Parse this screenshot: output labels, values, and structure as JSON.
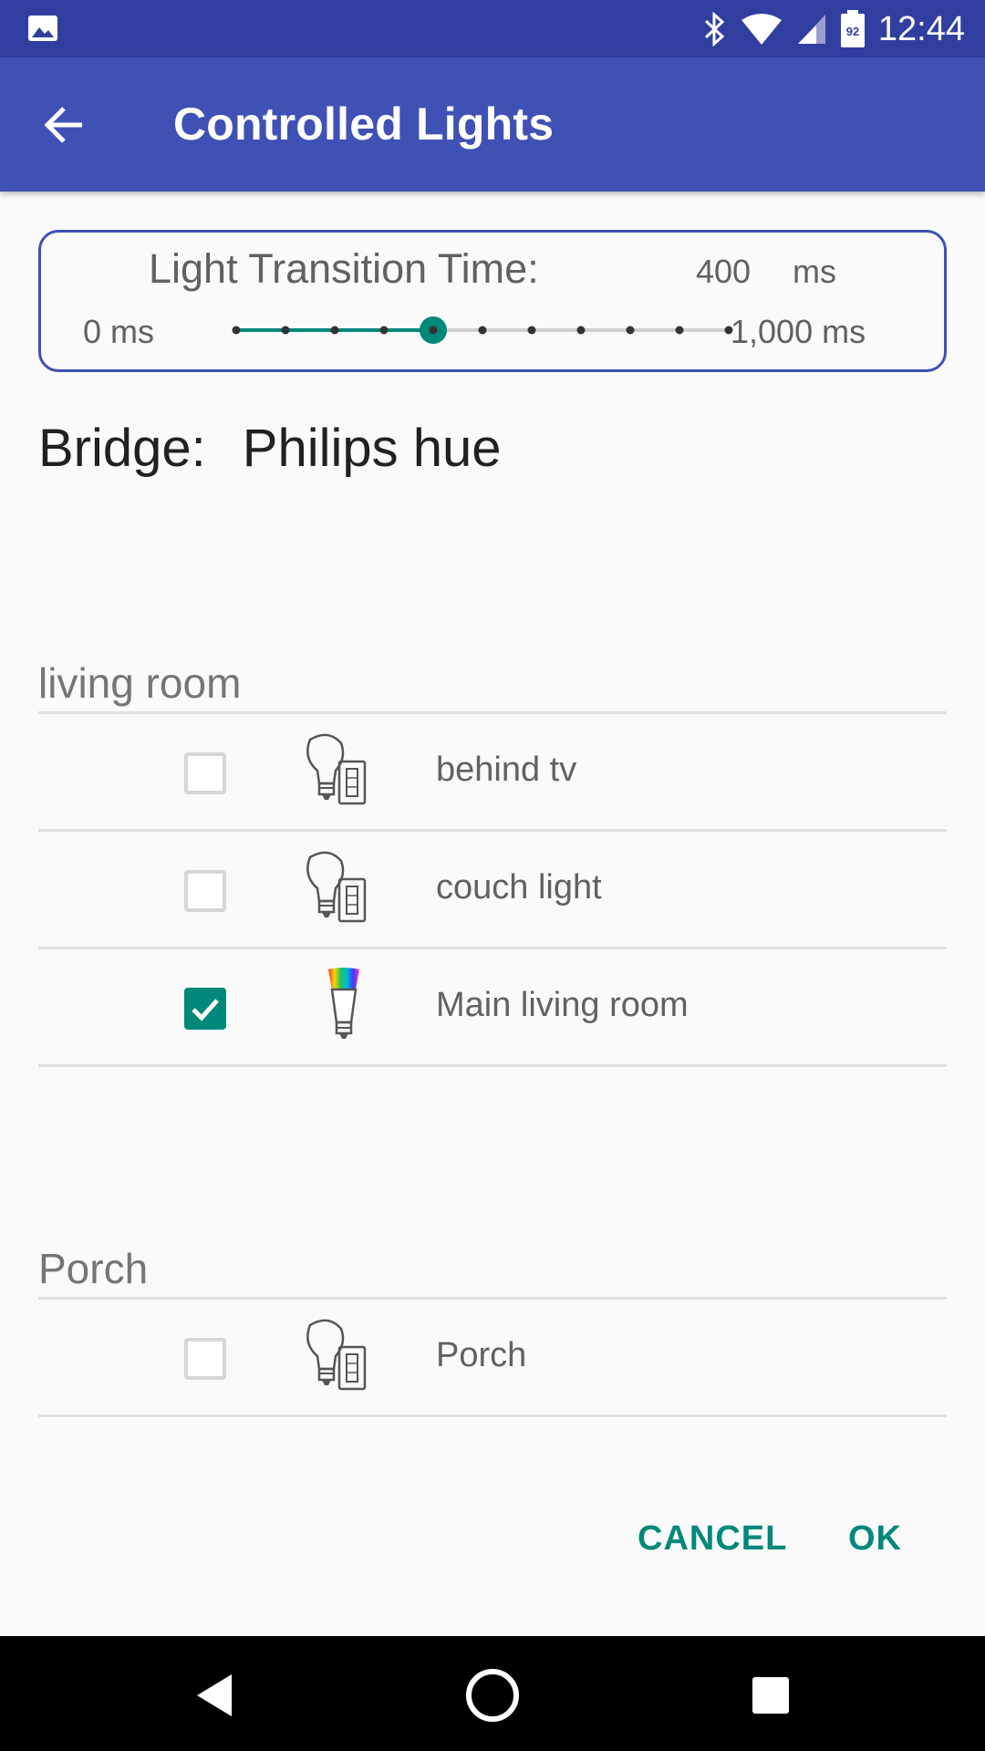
{
  "status_bar": {
    "time": "12:44",
    "battery": "92"
  },
  "app_bar": {
    "title": "Controlled Lights"
  },
  "transition": {
    "label": "Light Transition Time:",
    "value": "400",
    "unit": "ms",
    "min_label": "0 ms",
    "max_label": "1,000 ms",
    "slider_fraction": 0.4
  },
  "bridge": {
    "label": "Bridge:",
    "name": "Philips hue"
  },
  "groups": [
    {
      "name": "living room",
      "lights": [
        {
          "label": "behind tv",
          "checked": false,
          "icon": "white-bulb-with-switch-icon"
        },
        {
          "label": "couch light",
          "checked": false,
          "icon": "white-bulb-with-switch-icon"
        },
        {
          "label": "Main living room",
          "checked": true,
          "icon": "color-bulb-icon"
        }
      ]
    },
    {
      "name": "Porch",
      "lights": [
        {
          "label": "Porch",
          "checked": false,
          "icon": "white-bulb-with-switch-icon"
        }
      ]
    }
  ],
  "actions": {
    "cancel": "CANCEL",
    "ok": "OK"
  },
  "colors": {
    "primary": "#3f51b5",
    "primary_dark": "#303f9f",
    "accent": "#00897b"
  }
}
